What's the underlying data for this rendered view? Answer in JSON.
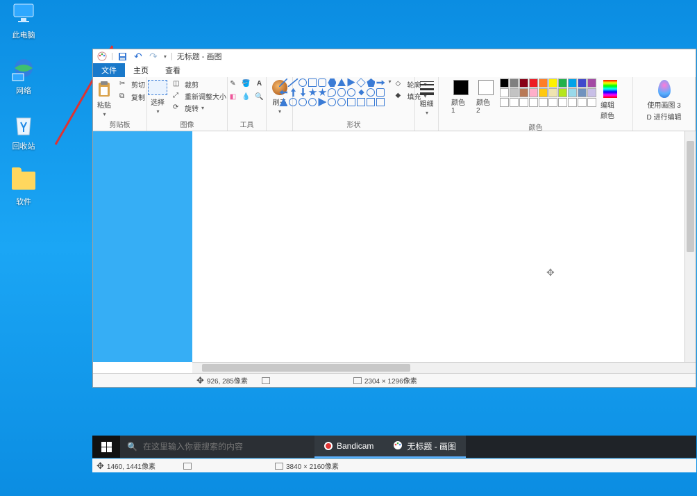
{
  "desktop": {
    "thispc": "此电脑",
    "network": "网络",
    "recycle": "回收站",
    "software": "软件",
    "software2": "软件"
  },
  "paint": {
    "title": "无标题 - 画图",
    "tabs": {
      "file": "文件",
      "home": "主页",
      "view": "查看"
    },
    "groups": {
      "clipboard": {
        "label": "剪贴板",
        "paste": "粘贴",
        "cut": "剪切",
        "copy": "复制"
      },
      "image": {
        "label": "图像",
        "select": "选择",
        "crop": "裁剪",
        "resize": "重新调整大小",
        "rotate": "旋转"
      },
      "tools": {
        "label": "工具"
      },
      "brushes": {
        "label": "刷子"
      },
      "shapes": {
        "label": "形状",
        "outline": "轮廓",
        "fill": "填充"
      },
      "stroke": {
        "label": "粗细"
      },
      "color1": "颜色 1",
      "color2": "颜色 2",
      "colors_label": "颜色",
      "edit_colors": "编辑颜色",
      "paint3d_line1": "使用画图 3",
      "paint3d_line2": "D 进行编辑"
    },
    "status": {
      "pos": "926, 285像素",
      "size": "2304 × 1296像素"
    }
  },
  "taskbar": {
    "search_placeholder": "在这里输入你要搜索的内容",
    "bandicam": "Bandicam",
    "paint": "无标题 - 画图"
  },
  "outer_status": {
    "pos": "1460, 1441像素",
    "size": "3840 × 2160像素"
  },
  "palette": [
    "#000000",
    "#7f7f7f",
    "#880015",
    "#ed1c24",
    "#ff7f27",
    "#fff200",
    "#22b14c",
    "#00a2e8",
    "#3f48cc",
    "#a349a4",
    "#ffffff",
    "#c3c3c3",
    "#b97a57",
    "#ffaec9",
    "#ffc90e",
    "#efe4b0",
    "#b5e61d",
    "#99d9ea",
    "#7092be",
    "#c8bfe7",
    "#ffffff",
    "#ffffff",
    "#ffffff",
    "#ffffff",
    "#ffffff",
    "#ffffff",
    "#ffffff",
    "#ffffff",
    "#ffffff",
    "#ffffff"
  ]
}
